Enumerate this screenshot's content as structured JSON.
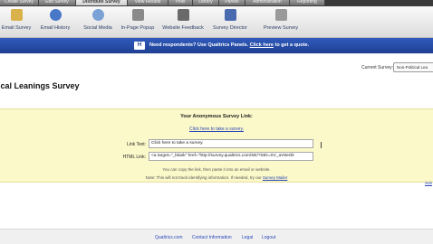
{
  "top_tabs": [
    "Create Survey",
    "Edit Survey",
    "Distribute Survey",
    "View Results",
    "Polls",
    "Library",
    "Panels",
    "Administration",
    "Reporting"
  ],
  "toolbar": {
    "items": [
      {
        "label": "Email Survey",
        "icon": "email-survey-icon",
        "color": "#d9b24c"
      },
      {
        "label": "Email History",
        "icon": "email-history-icon",
        "color": "#4a78c8"
      },
      {
        "label": "Social Media",
        "icon": "social-media-icon",
        "color": "#7aa2d6"
      },
      {
        "label": "In-Page Popup",
        "icon": "in-page-popup-icon",
        "color": "#8a8a8a"
      },
      {
        "label": "Website Feedback",
        "icon": "website-feedback-icon",
        "color": "#6a6a6a"
      },
      {
        "label": "Survey Director",
        "icon": "survey-director-icon",
        "color": "#4a6ab0"
      },
      {
        "label": "Preview Survey",
        "icon": "preview-survey-icon",
        "color": "#9a9a9a"
      }
    ]
  },
  "banner": {
    "badge": "H",
    "text_prefix": "Need respondents? Use Qualtrics Panels.",
    "link_text": "Click here",
    "text_suffix": "to get a quote.",
    "color": "#2f5bbd"
  },
  "main": {
    "current_survey_label": "Current Survey:",
    "current_survey_value": "Non-Political Lea",
    "title": "ical Leanings Survey",
    "anon_link_title": "Your Anonymous Survey Link:",
    "survey_link": "Click here to take a survey.",
    "link_text_label": "Link Text:",
    "link_text_value": "Click here to take a survey.",
    "html_link_label": "HTML Link:",
    "html_link_value": "<a target=\"_blank\" href=\"http://survey.qualtrics.com/SE/?SID=SV_aV6eOk",
    "hint1": "You can copy the link, then paste it into an email or website.",
    "hint2_prefix": "Note: This will not track identifying information. If needed, try our",
    "hint2_link": "Survey Mailer",
    "edge_link": "Sub"
  },
  "footer": {
    "links": [
      "Qualtrics.com",
      "Contact Information",
      "Legal",
      "Logout"
    ]
  }
}
